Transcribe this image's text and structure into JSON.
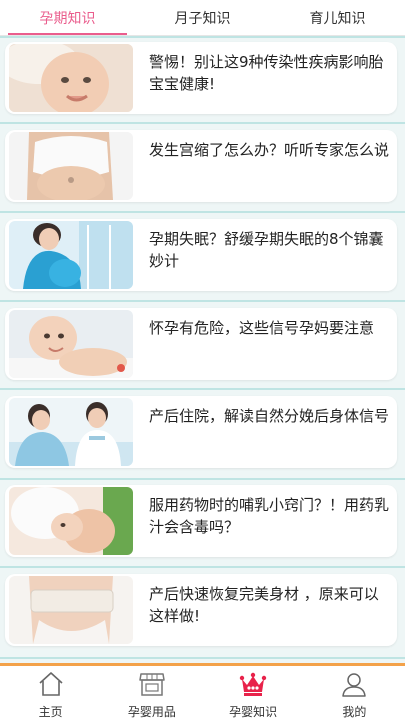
{
  "tabs": [
    {
      "label": "孕期知识",
      "active": true
    },
    {
      "label": "月子知识",
      "active": false
    },
    {
      "label": "育儿知识",
      "active": false
    }
  ],
  "articles": [
    {
      "title": "警惕！别让这9种传染性疾病影响胎宝宝健康!",
      "thumb": "baby-face-photo"
    },
    {
      "title": "发生宫缩了怎么办？听听专家怎么说",
      "thumb": "pregnant-belly-photo"
    },
    {
      "title": "孕期失眠？舒缓孕期失眠的8个锦囊妙计",
      "thumb": "pregnant-woman-window-photo"
    },
    {
      "title": "怀孕有危险，这些信号孕妈要注意",
      "thumb": "baby-crawling-photo"
    },
    {
      "title": "产后住院，解读自然分娩后身体信号",
      "thumb": "nurse-mother-photo"
    },
    {
      "title": "服用药物时的哺乳小窍门？！用药乳汁会含毒吗？",
      "thumb": "breastfeeding-photo"
    },
    {
      "title": "产后快速恢复完美身材 ，原来可以这样做!",
      "thumb": "postpartum-belt-photo"
    }
  ],
  "bottom_nav": [
    {
      "label": "主页",
      "icon": "home-icon",
      "active": false
    },
    {
      "label": "孕婴用品",
      "icon": "shop-icon",
      "active": false
    },
    {
      "label": "孕婴知识",
      "icon": "crown-icon",
      "active": true
    },
    {
      "label": "我的",
      "icon": "user-icon",
      "active": false
    }
  ],
  "colors": {
    "accent": "#ea5d8d",
    "separator": "#bfe4e3",
    "bottom_line": "#f3a24a",
    "crown": "#e8224a"
  }
}
